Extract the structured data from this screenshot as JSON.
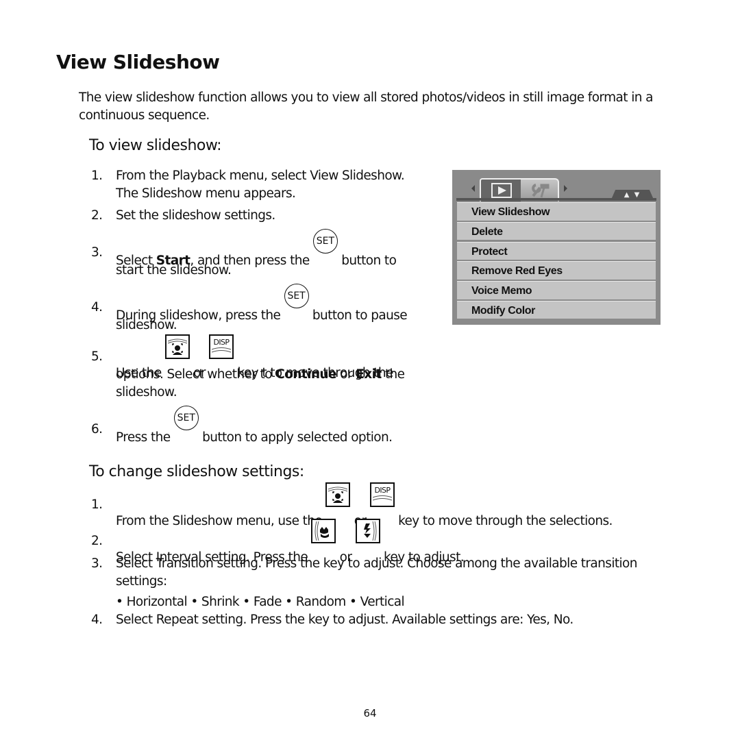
{
  "title": "View Slideshow",
  "intro": "The view slideshow function allows you to view all stored photos/videos in still image format in a continuous sequence.",
  "section1": {
    "heading": "To view slideshow:",
    "steps": [
      {
        "num": "1.",
        "line1": "From the Playback menu, select View Slideshow.",
        "line2": "The Slideshow menu appears."
      },
      {
        "num": "2.",
        "text": "Set the slideshow settings."
      },
      {
        "num": "3.",
        "pre": "Select ",
        "bold": "Start",
        "mid": ", and then press the",
        "post": "button to",
        "line2": "start the slideshow."
      },
      {
        "num": "4.",
        "pre": "During slideshow, press the",
        "post": "button to pause",
        "line2": "slideshow."
      },
      {
        "num": "5.",
        "pre": "Use the",
        "or": "or",
        "post": "key t to move through the",
        "line2a": "options. Select whether to ",
        "bold1": "Continue",
        "or2": " or ",
        "bold2": "Exit",
        "line2b": " the",
        "line3": "slideshow."
      },
      {
        "num": "6.",
        "pre": "Press the",
        "post": "button to apply selected option."
      }
    ]
  },
  "section2": {
    "heading": "To change slideshow settings:",
    "steps": [
      {
        "num": "1.",
        "pre": "From the Slideshow menu, use the",
        "or": "or",
        "post": "key to move through the selections."
      },
      {
        "num": "2.",
        "pre": "Select Interval setting. Press the",
        "or": "or",
        "post": "key to adjust."
      },
      {
        "num": "3.",
        "line1": "Select Transition setting. Press the key to adjust. Choose among the available transition",
        "line2": "settings:",
        "options": "• Horizontal • Shrink • Fade • Random • Vertical"
      },
      {
        "num": "4.",
        "text": "Select Repeat setting. Press the key to adjust. Available settings are: Yes, No."
      }
    ]
  },
  "keys": {
    "set": "SET",
    "disp": "DISP"
  },
  "menu": {
    "tabs": [
      "playback-tab",
      "setup-tab"
    ],
    "updown": "▲ ▼",
    "items": [
      "View Slideshow",
      "Delete",
      "Protect",
      "Remove Red Eyes",
      "Voice Memo",
      "Modify Color"
    ]
  },
  "page_number": "64"
}
